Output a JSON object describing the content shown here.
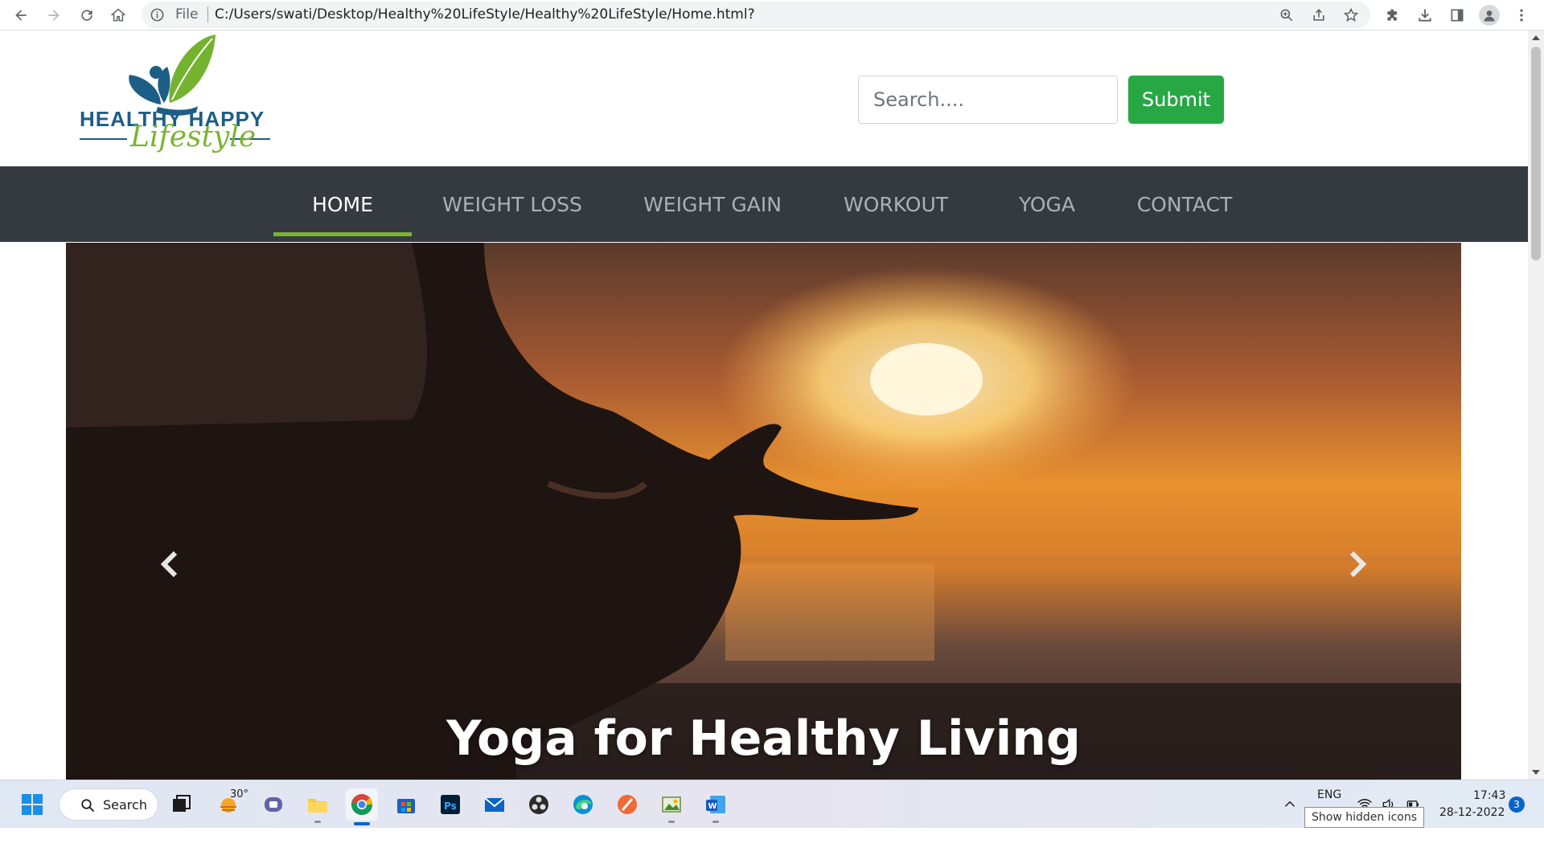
{
  "browser": {
    "file_label": "File",
    "url": "C:/Users/swati/Desktop/Healthy%20LifeStyle/Healthy%20LifeStyle/Home.html?"
  },
  "site": {
    "logo_line1": "HEALTHY HAPPY",
    "logo_line2": "Lifestyle",
    "search_placeholder": "Search....",
    "submit_label": "Submit",
    "nav": [
      {
        "label": "HOME",
        "active": true
      },
      {
        "label": "WEIGHT LOSS",
        "active": false
      },
      {
        "label": "WEIGHT GAIN",
        "active": false
      },
      {
        "label": "WORKOUT",
        "active": false
      },
      {
        "label": "YOGA",
        "active": false
      },
      {
        "label": "CONTACT",
        "active": false
      }
    ],
    "carousel_caption": "Yoga for Healthy Living"
  },
  "taskbar": {
    "search_label": "Search",
    "weather_temp": "30°",
    "language": "ENG",
    "time": "17:43",
    "date": "28-12-2022",
    "notification_count": "3",
    "tooltip": "Show hidden icons"
  },
  "colors": {
    "nav_bg": "#343a40",
    "accent_green": "#79b532",
    "submit_green": "#28a745",
    "logo_blue": "#1d5e86"
  }
}
